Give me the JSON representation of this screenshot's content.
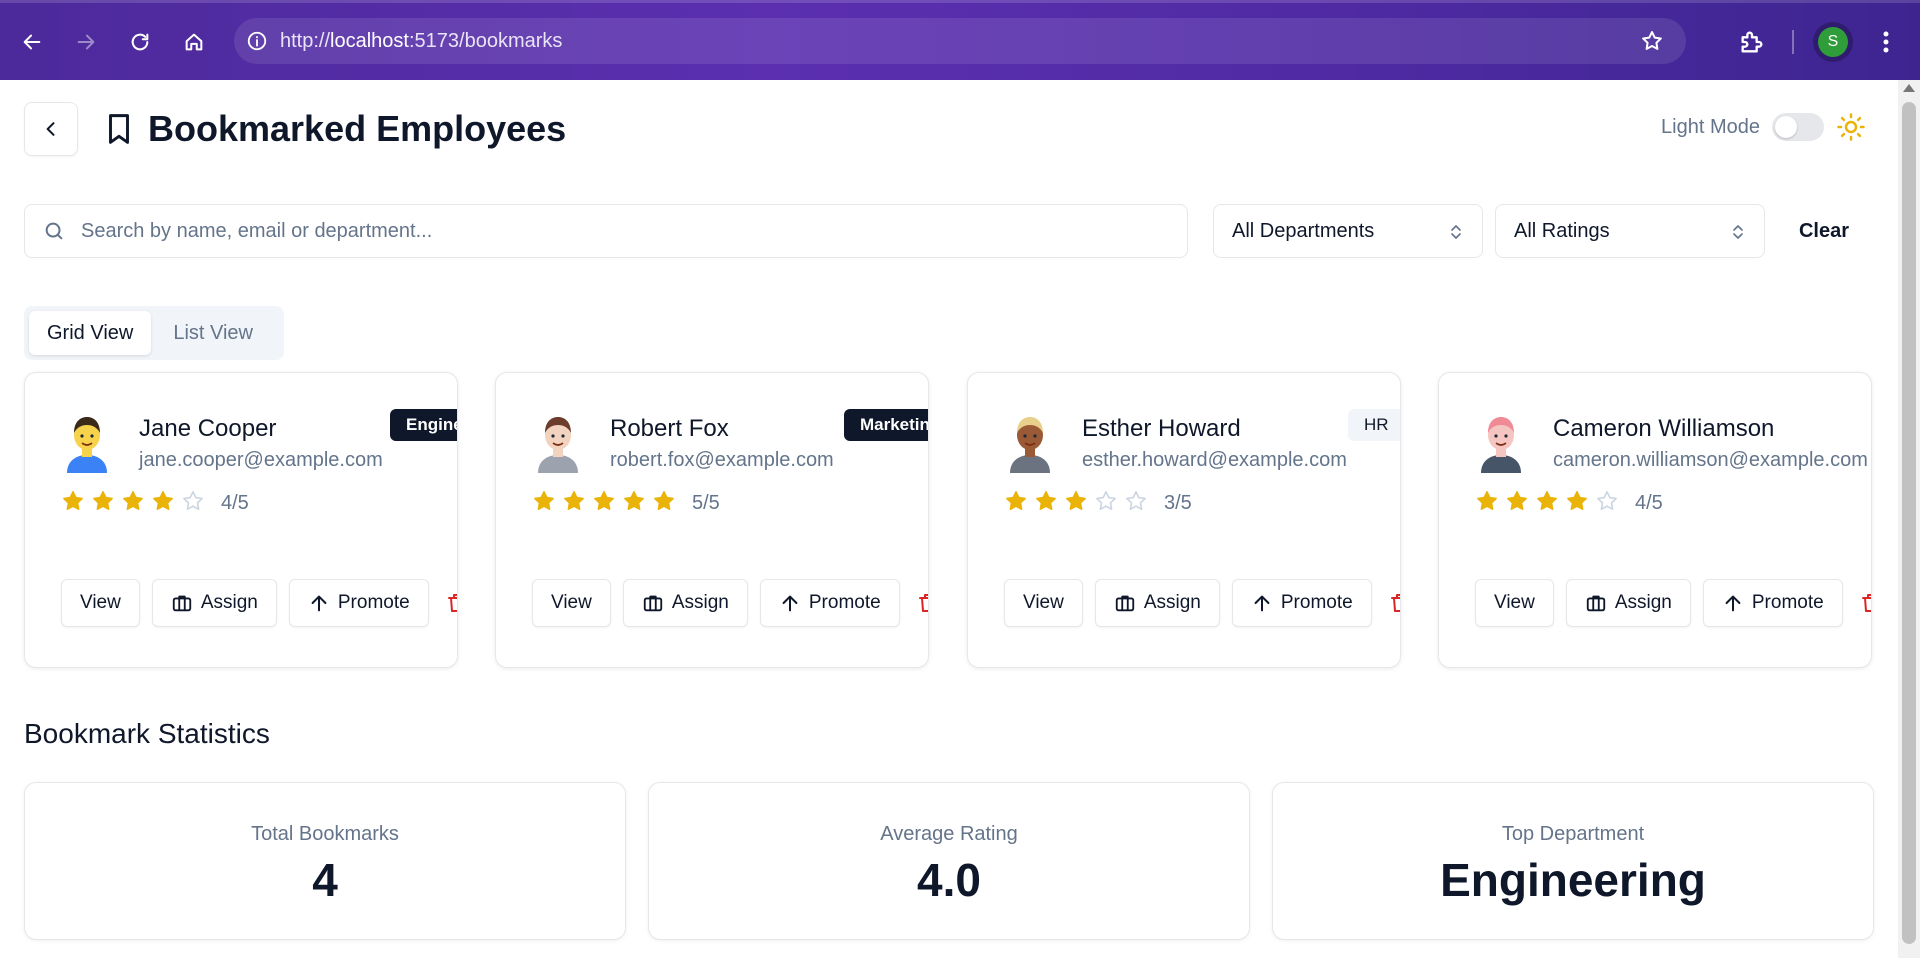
{
  "browser": {
    "url_prefix": "http://",
    "url_host": "localhost",
    "url_rest": ":5173/bookmarks",
    "profile_initial": "S"
  },
  "header": {
    "title": "Bookmarked Employees",
    "mode_label": "Light Mode"
  },
  "filters": {
    "search_placeholder": "Search by name, email or department...",
    "department_select": "All Departments",
    "rating_select": "All Ratings",
    "clear_label": "Clear"
  },
  "view_toggle": {
    "grid_label": "Grid View",
    "list_label": "List View",
    "active": "grid"
  },
  "colors": {
    "star_filled": "#eab308",
    "star_empty": "#cbd5e1",
    "trash": "#dc2626"
  },
  "employees": [
    {
      "name": "Jane Cooper",
      "email": "jane.cooper@example.com",
      "department": "Engineering",
      "rating": 4,
      "rating_text": "4/5",
      "avatar": "avatar-jane"
    },
    {
      "name": "Robert Fox",
      "email": "robert.fox@example.com",
      "department": "Marketing",
      "rating": 5,
      "rating_text": "5/5",
      "avatar": "avatar-robert"
    },
    {
      "name": "Esther Howard",
      "email": "esther.howard@example.com",
      "department": "HR",
      "rating": 3,
      "rating_text": "3/5",
      "avatar": "avatar-esther"
    },
    {
      "name": "Cameron Williamson",
      "email": "cameron.williamson@example.com",
      "department": "",
      "rating": 4,
      "rating_text": "4/5",
      "avatar": "avatar-cameron"
    }
  ],
  "card_actions": {
    "view": "View",
    "assign": "Assign",
    "promote": "Promote"
  },
  "stats": {
    "title": "Bookmark Statistics",
    "total_label": "Total Bookmarks",
    "total_value": "4",
    "avg_label": "Average Rating",
    "avg_value": "4.0",
    "top_label": "Top Department",
    "top_value": "Engineering"
  }
}
